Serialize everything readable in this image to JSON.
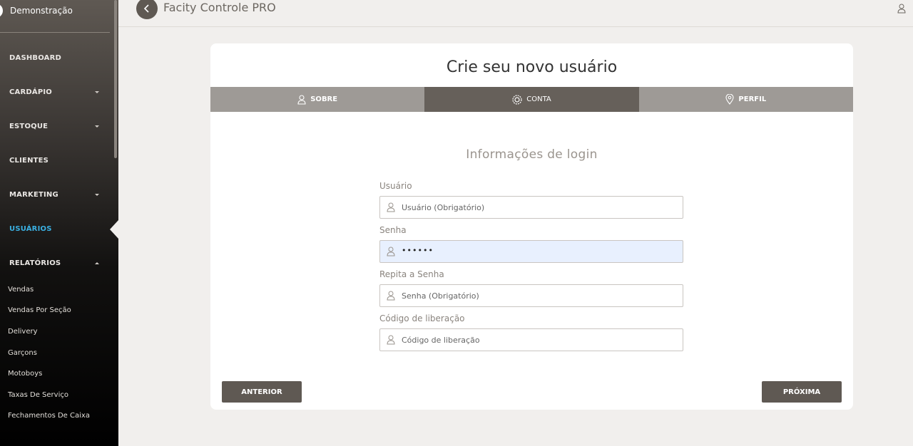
{
  "sidebar": {
    "user_name": "Demonstração",
    "nav": [
      {
        "label": "DASHBOARD"
      },
      {
        "label": "CARDÁPIO"
      },
      {
        "label": "ESTOQUE"
      },
      {
        "label": "CLIENTES"
      },
      {
        "label": "MARKETING"
      },
      {
        "label": "USUÁRIOS"
      },
      {
        "label": "RELATÓRIOS"
      }
    ],
    "reports": [
      {
        "label": "Vendas"
      },
      {
        "label": "Vendas Por Seção"
      },
      {
        "label": "Delivery"
      },
      {
        "label": "Garçons"
      },
      {
        "label": "Motoboys"
      },
      {
        "label": "Taxas De Serviço"
      },
      {
        "label": "Fechamentos De Caixa"
      }
    ],
    "active_color": "#3ab0e2"
  },
  "header": {
    "title": "Facity Controle PRO"
  },
  "wizard": {
    "title": "Crie seu novo usuário",
    "tabs": [
      {
        "label": "SOBRE",
        "icon": "user-icon"
      },
      {
        "label": "CONTA",
        "icon": "settings-icon"
      },
      {
        "label": "PERFIL",
        "icon": "location-pin-icon"
      }
    ],
    "section_title": "Informações de login",
    "fields": {
      "usuario": {
        "label": "Usuário",
        "placeholder": "Usuário (Obrigatório)"
      },
      "senha": {
        "label": "Senha",
        "value": "••••••"
      },
      "repita": {
        "label": "Repita a Senha",
        "placeholder": "Senha (Obrigatório)"
      },
      "codigo": {
        "label": "Código de liberação",
        "placeholder": "Código de liberação"
      }
    },
    "prev_label": "ANTERIOR",
    "next_label": "PRÓXIMA"
  }
}
